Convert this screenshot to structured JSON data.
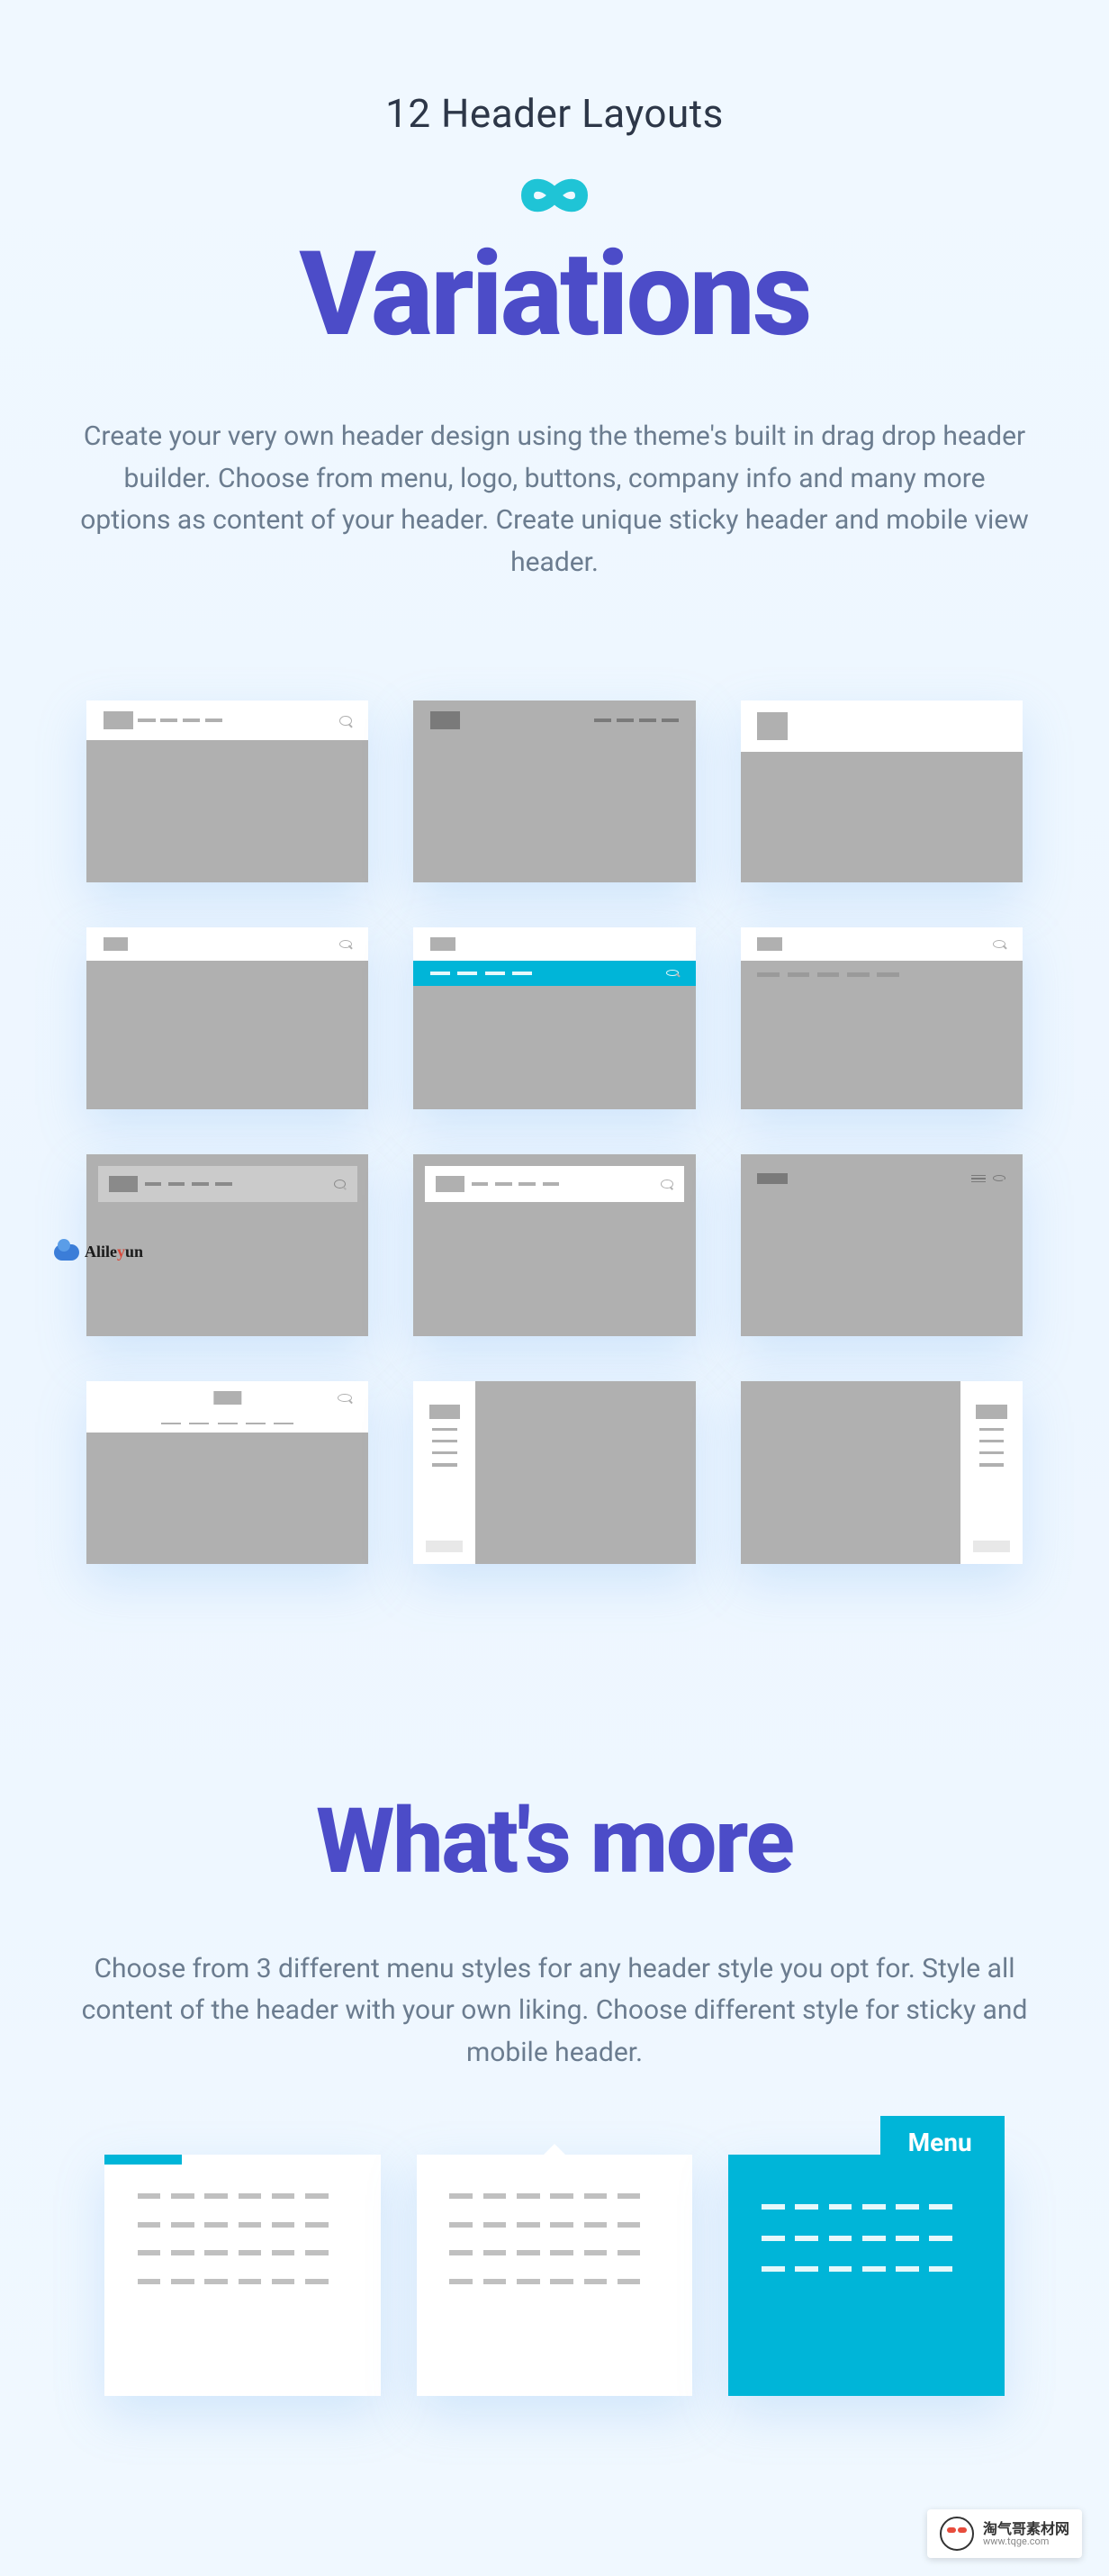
{
  "section1": {
    "pretitle": "12 Header Layouts",
    "title": "Variations",
    "description": "Create your very own header design using the theme's built in drag drop header builder. Choose from menu, logo, buttons, company info and many more options as content of your header. Create unique sticky header and mobile view header."
  },
  "section2": {
    "title": "What's more",
    "description": "Choose from 3 different menu styles for any header style you opt for. Style all content of the header with your own liking. Choose different style for sticky and mobile header.",
    "menu_tab_label": "Menu"
  },
  "watermarks": {
    "left_brand": "Alileyun",
    "bottom_brand": "淘气哥素材网",
    "bottom_url": "www.tqge.com"
  }
}
